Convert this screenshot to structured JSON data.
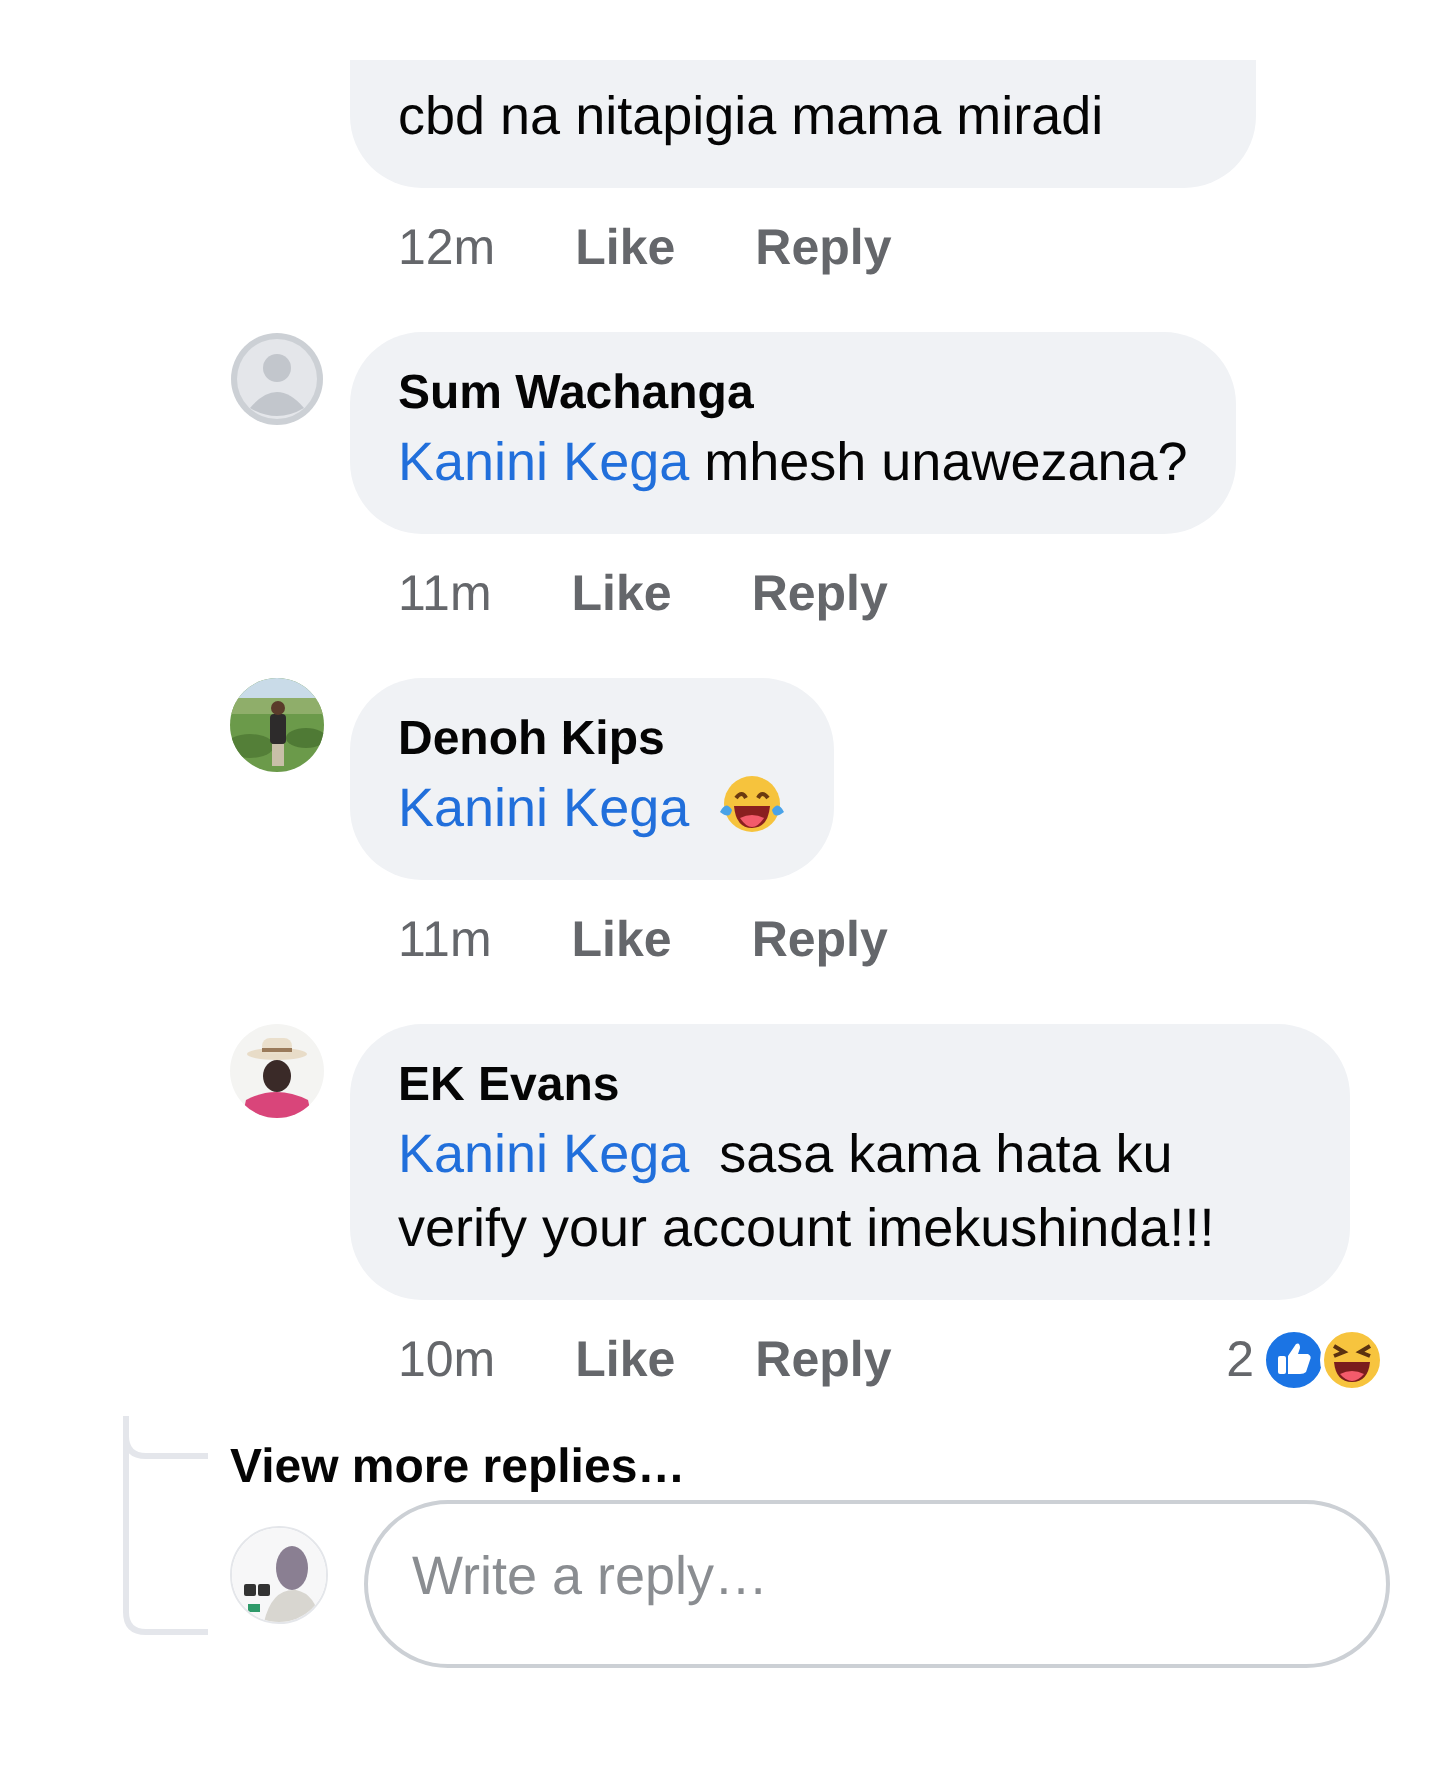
{
  "comments": [
    {
      "text": "cbd na nitapigia mama miradi",
      "time": "12m",
      "actions": [
        "Like",
        "Reply"
      ]
    },
    {
      "avatar": {
        "kind": "default"
      },
      "author": "Sum Wachanga",
      "mention": "Kanini Kega",
      "text": " mhesh unawezana?",
      "time": "11m",
      "actions": [
        "Like",
        "Reply"
      ]
    },
    {
      "author": "Denoh Kips",
      "mention": "Kanini Kega",
      "trailing_emoji": true,
      "time": "11m",
      "actions": [
        "Like",
        "Reply"
      ]
    },
    {
      "author": "EK Evans",
      "mention": "Kanini Kega",
      "text": "  sasa kama hata ku verify your account imekushinda!!!",
      "time": "10m",
      "actions": [
        "Like",
        "Reply"
      ],
      "reaction_count": "2"
    }
  ],
  "view_more": "View more replies…",
  "reply_box": {
    "placeholder": "Write a reply…"
  }
}
